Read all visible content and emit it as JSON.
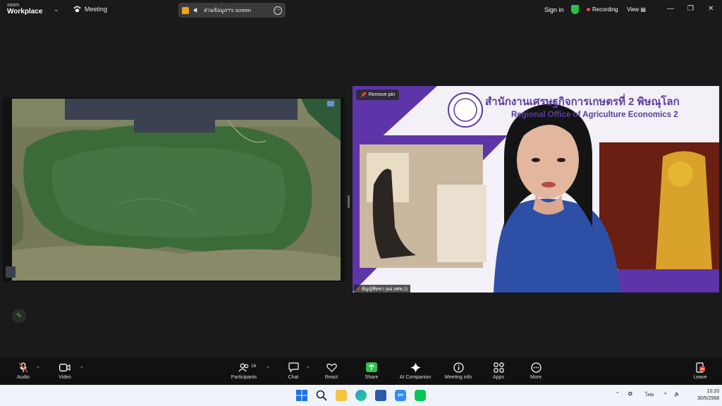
{
  "titlebar": {
    "brand_top": "zoom",
    "brand_bottom": "Workplace",
    "meeting_label": "Meeting",
    "share_name": "ส่วนข้อมูลฯ's screen",
    "more": "⋯",
    "sign_in": "Sign in",
    "recording": "Recording",
    "view": "View",
    "minimize": "—",
    "restore": "❐",
    "close": "✕",
    "colors": {
      "record_dot": "#e74c3c",
      "shield": "#2fbf4a",
      "share_icon": "#f2a31b"
    }
  },
  "video": {
    "remove_pin": "Remove pin",
    "participant_name": "ธัญญ์ชิษชา (ผอ.สศท.2)",
    "banner_thai": "สำนักงานเศรษฐกิจการเกษตรที่ 2 พิษณุโลก",
    "banner_english": "Regional Office of Agriculture Economics 2",
    "accent_color": "#5b3ca0"
  },
  "toolbar": {
    "items": [
      {
        "label": "Audio",
        "icon": "mic-muted-icon"
      },
      {
        "label": "Video",
        "icon": "video-icon"
      },
      {
        "label": "Participants",
        "icon": "participants-icon",
        "count": "16"
      },
      {
        "label": "Chat",
        "icon": "chat-icon"
      },
      {
        "label": "React",
        "icon": "heart-icon"
      },
      {
        "label": "Share",
        "icon": "share-icon"
      },
      {
        "label": "AI Companion",
        "icon": "sparkle-icon"
      },
      {
        "label": "Meeting info",
        "icon": "info-icon"
      },
      {
        "label": "Apps",
        "icon": "apps-icon"
      },
      {
        "label": "More",
        "icon": "more-icon"
      },
      {
        "label": "Leave",
        "icon": "leave-icon"
      }
    ],
    "share_color": "#2fbf4a",
    "leave_color": "#e74c3c"
  },
  "taskbar": {
    "language": "ไทย",
    "time": "10:20",
    "date": "30/5/2568"
  }
}
